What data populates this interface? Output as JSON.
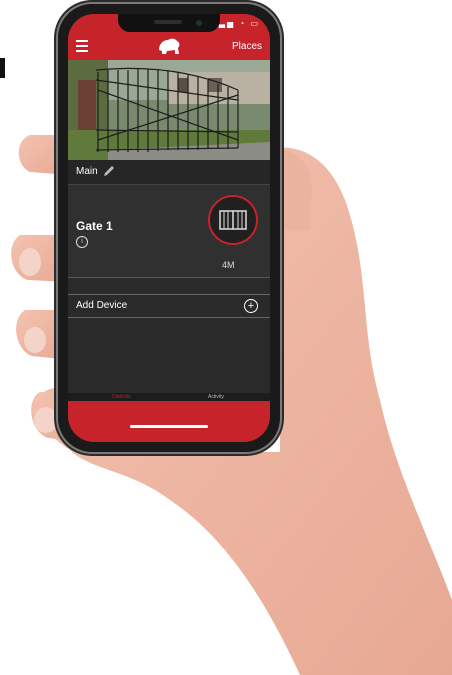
{
  "app": {
    "statusbar": {
      "time": "",
      "icons": "▂▃▅ ◔ ▭"
    },
    "appbar": {
      "places_label": "Places",
      "logo_icon": "lion-icon",
      "menu_icon": "hamburger-menu-icon"
    },
    "section": {
      "title": "Main",
      "edit_icon": "pencil-icon"
    },
    "device": {
      "name": "Gate 1",
      "info_icon": "info-icon",
      "gate_icon": "gate-icon",
      "gate_status": "4M"
    },
    "add_device": {
      "label": "Add Device",
      "icon": "plus-circle-icon"
    },
    "tabs": [
      {
        "label": "Controls",
        "active": true
      },
      {
        "label": "Activity",
        "active": false
      }
    ],
    "colors": {
      "accent": "#c6232b",
      "background": "#2a2a2a",
      "text": "#ffffff"
    }
  }
}
